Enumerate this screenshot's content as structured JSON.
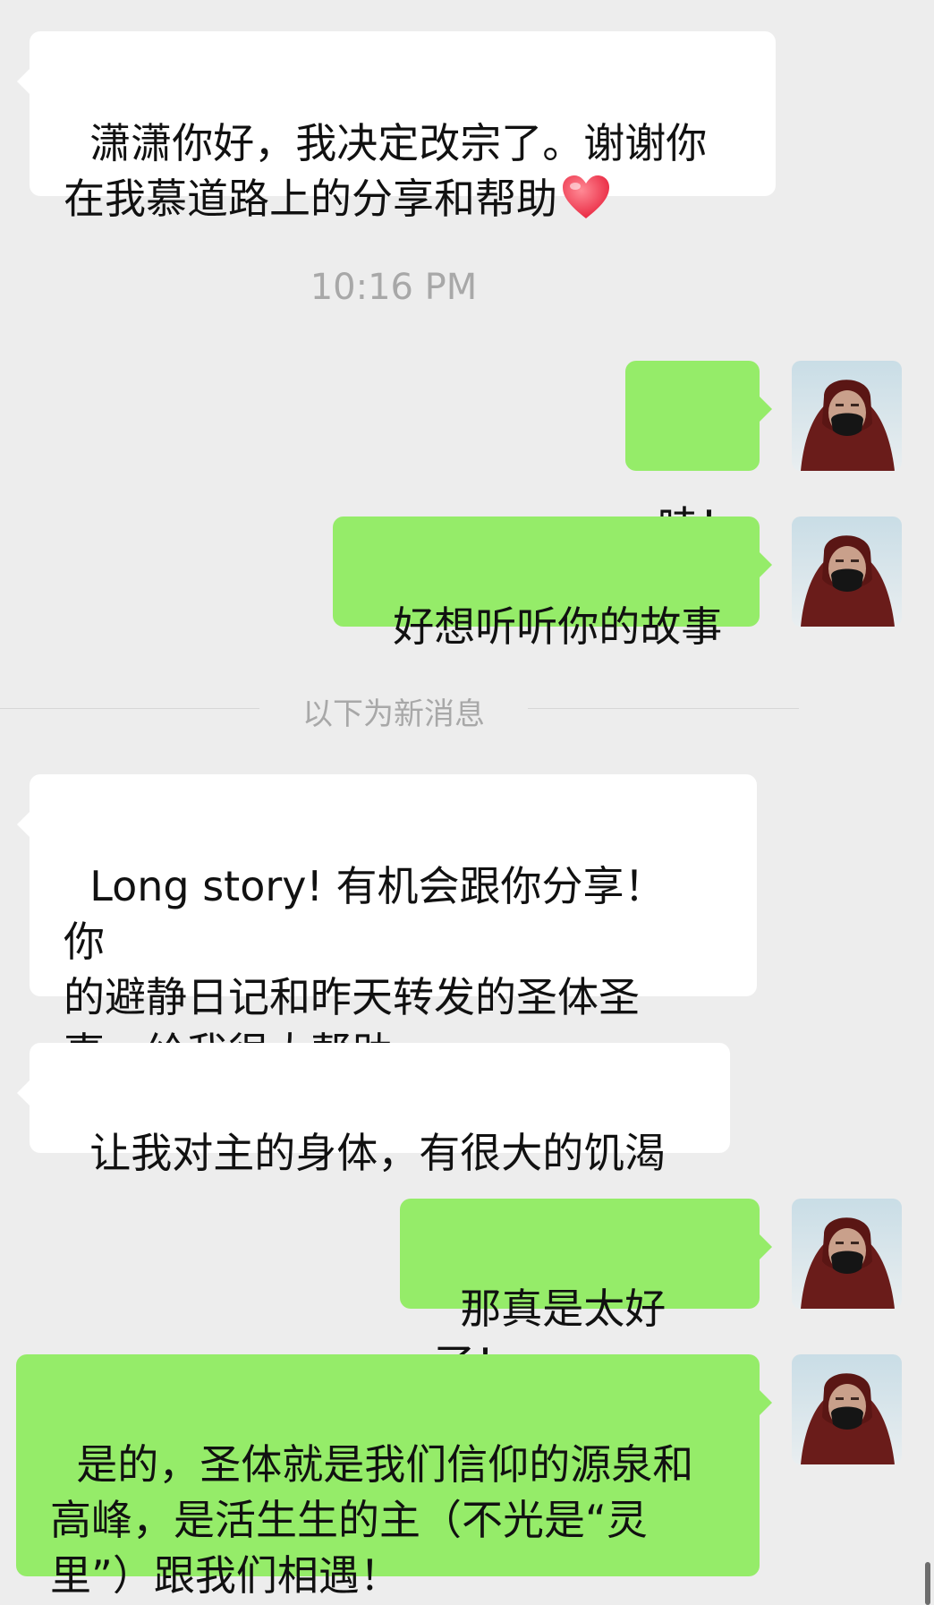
{
  "messages": [
    {
      "side": "left",
      "text": "潇潇你好，我决定改宗了。谢谢你\n在我慕道路上的分享和帮助",
      "emoji": "heart"
    },
    {
      "side": "right",
      "text": "哇！"
    },
    {
      "side": "right",
      "text": "好想听听你的故事"
    },
    {
      "side": "left",
      "text": "Long story! 有机会跟你分享！  你\n的避静日记和昨天转发的圣体圣\n事，给我很大帮助"
    },
    {
      "side": "left",
      "text": "让我对主的身体，有很大的饥渴"
    },
    {
      "side": "right",
      "text": "那真是太好了！"
    },
    {
      "side": "right",
      "text": "是的，圣体就是我们信仰的源泉和\n高峰，是活生生的主（不光是“灵\n里”）跟我们相遇！"
    }
  ],
  "timestamp": "10:16 PM",
  "new_messages_divider": "以下为新消息",
  "colors": {
    "background": "#ededed",
    "incoming_bubble": "#ffffff",
    "outgoing_bubble": "#95ec69",
    "meta_text": "#a8a8a8"
  },
  "icons": {
    "avatar": "user-avatar-photo",
    "emoji": "red-heart-emoji"
  }
}
